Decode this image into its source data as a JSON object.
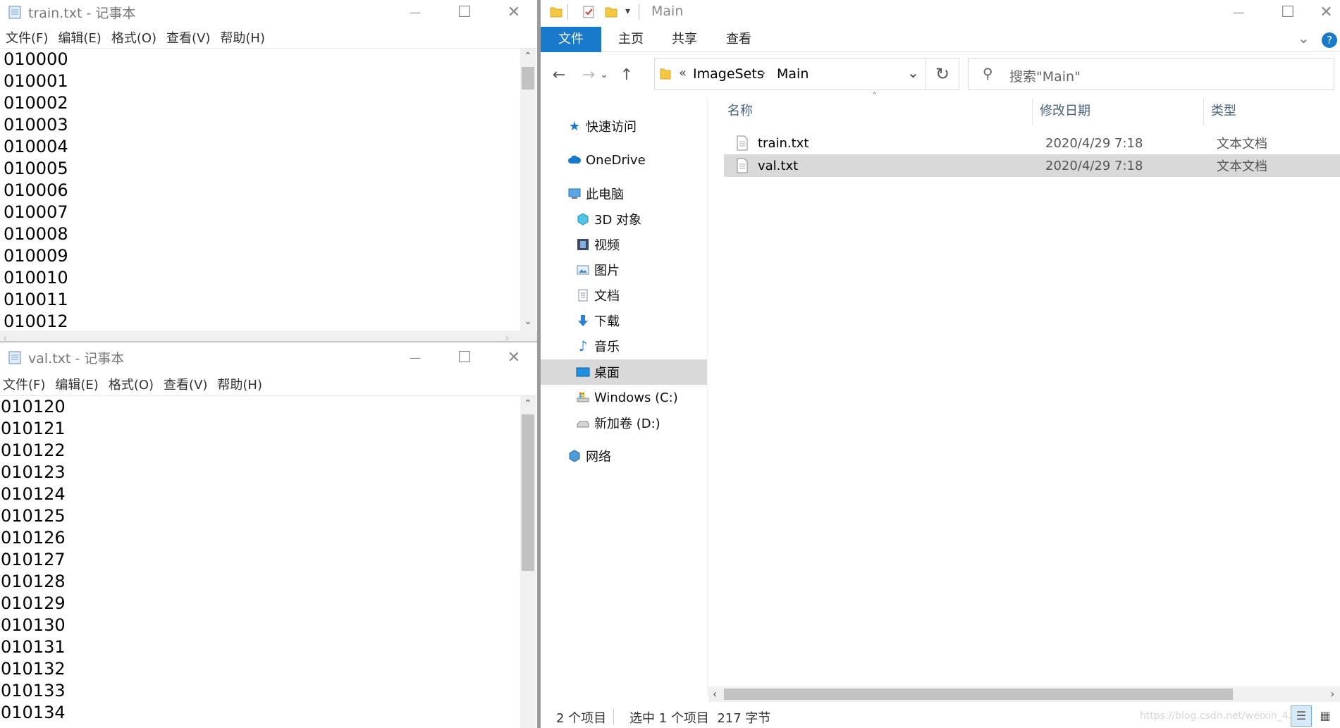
{
  "notepad_top": {
    "title": "train.txt - 记事本",
    "menu": [
      "文件(F)",
      "编辑(E)",
      "格式(O)",
      "查看(V)",
      "帮助(H)"
    ],
    "lines": [
      "010000",
      "010001",
      "010002",
      "010003",
      "010004",
      "010005",
      "010006",
      "010007",
      "010008",
      "010009",
      "010010",
      "010011",
      "010012"
    ]
  },
  "notepad_bottom": {
    "title": "val.txt - 记事本",
    "menu": [
      "文件(F)",
      "编辑(E)",
      "格式(O)",
      "查看(V)",
      "帮助(H)"
    ],
    "lines": [
      "010120",
      "010121",
      "010122",
      "010123",
      "010124",
      "010125",
      "010126",
      "010127",
      "010128",
      "010129",
      "010130",
      "010131",
      "010132",
      "010133",
      "010134"
    ]
  },
  "caption_buttons": {
    "minimize": "—",
    "maximize": "☐",
    "close": "✕"
  },
  "explorer": {
    "title": "Main",
    "ribbon_tabs": [
      "文件",
      "主页",
      "共享",
      "查看"
    ],
    "breadcrumb": {
      "prefix": "«",
      "items": [
        "ImageSets",
        "Main"
      ]
    },
    "search_placeholder": "搜索\"Main\"",
    "nav": [
      {
        "label": "快速访问",
        "icon": "star-icon"
      },
      {
        "label": "OneDrive",
        "icon": "cloud-icon"
      },
      {
        "label": "此电脑",
        "icon": "computer-icon"
      },
      {
        "label": "3D 对象",
        "icon": "cube-icon"
      },
      {
        "label": "视频",
        "icon": "film-icon"
      },
      {
        "label": "图片",
        "icon": "picture-icon"
      },
      {
        "label": "文档",
        "icon": "document-icon"
      },
      {
        "label": "下载",
        "icon": "download-icon"
      },
      {
        "label": "音乐",
        "icon": "music-icon"
      },
      {
        "label": "桌面",
        "icon": "desktop-icon"
      },
      {
        "label": "Windows (C:)",
        "icon": "drive-icon"
      },
      {
        "label": "新加卷 (D:)",
        "icon": "drive-icon"
      },
      {
        "label": "网络",
        "icon": "network-icon"
      }
    ],
    "columns": [
      "名称",
      "修改日期",
      "类型"
    ],
    "files": [
      {
        "name": "train.txt",
        "date": "2020/4/29 7:18",
        "type": "文本文档",
        "selected": false
      },
      {
        "name": "val.txt",
        "date": "2020/4/29 7:18",
        "type": "文本文档",
        "selected": true
      }
    ],
    "status": {
      "count": "2 个项目",
      "selection": "选中 1 个项目  217 字节"
    },
    "watermark": "https://blog.csdn.net/weixin_4..."
  },
  "colors": {
    "accent": "#1979ca",
    "selection": "#d9d9d9"
  }
}
